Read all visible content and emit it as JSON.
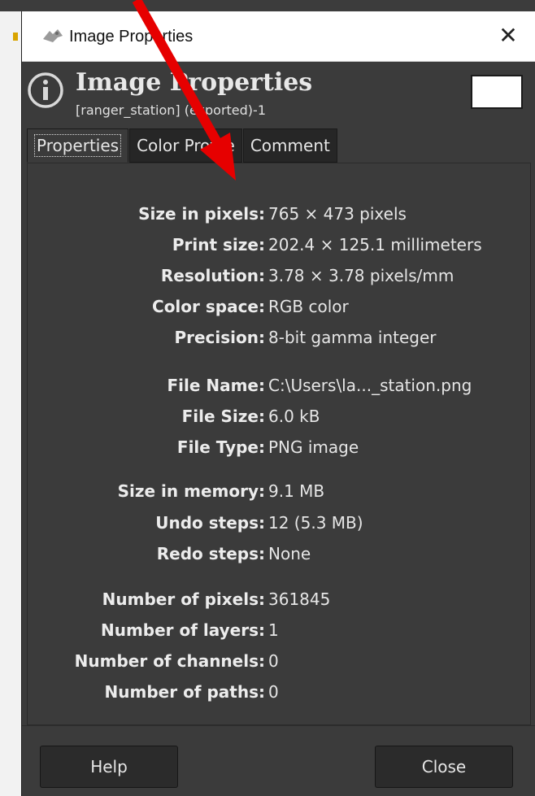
{
  "window": {
    "title": "Image Properties",
    "close_glyph": "✕"
  },
  "header": {
    "title": "Image Properties",
    "subtitle": "[ranger_station] (exported)-1",
    "icon": "info-icon"
  },
  "tabs": [
    {
      "label": "Properties",
      "active": true
    },
    {
      "label": "Color Profile",
      "active": false
    },
    {
      "label": "Comment",
      "active": false
    }
  ],
  "properties": [
    {
      "label": "Size in pixels:",
      "value": "765 × 473 pixels"
    },
    {
      "label": "Print size:",
      "value": "202.4 × 125.1 millimeters"
    },
    {
      "label": "Resolution:",
      "value": "3.78 × 3.78 pixels/mm"
    },
    {
      "label": "Color space:",
      "value": "RGB color"
    },
    {
      "label": "Precision:",
      "value": "8-bit gamma integer"
    },
    {
      "label": "File Name:",
      "value": "C:\\Users\\la..._station.png"
    },
    {
      "label": "File Size:",
      "value": "6.0 kB"
    },
    {
      "label": "File Type:",
      "value": "PNG image"
    },
    {
      "label": "Size in memory:",
      "value": "9.1 MB"
    },
    {
      "label": "Undo steps:",
      "value": "12 (5.3 MB)"
    },
    {
      "label": "Redo steps:",
      "value": "None"
    },
    {
      "label": "Number of pixels:",
      "value": "361845"
    },
    {
      "label": "Number of layers:",
      "value": "1"
    },
    {
      "label": "Number of channels:",
      "value": "0"
    },
    {
      "label": "Number of paths:",
      "value": "0"
    }
  ],
  "buttons": {
    "help": "Help",
    "close": "Close"
  },
  "colors": {
    "annotation_arrow": "#e60000",
    "dialog_background": "#3b3b3b"
  }
}
